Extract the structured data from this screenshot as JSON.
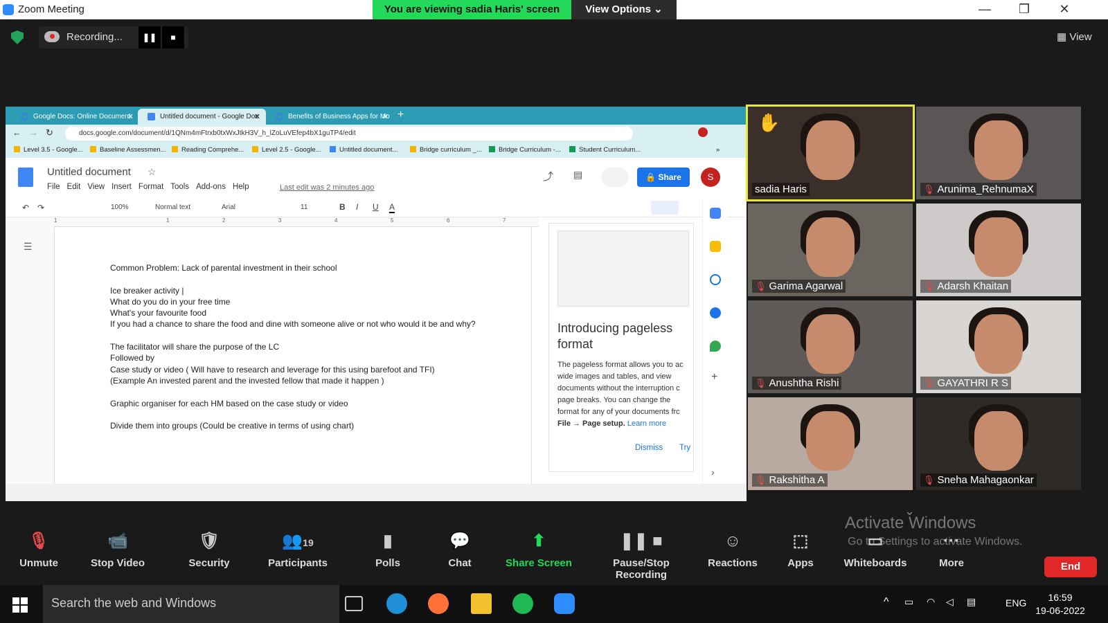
{
  "window": {
    "title": "Zoom Meeting",
    "viewing_banner": "You are viewing sadia Haris' screen",
    "view_options": "View Options ⌄"
  },
  "recording": {
    "label": "Recording...",
    "pause": "❚❚",
    "stop": "■"
  },
  "view_button": "View",
  "browser": {
    "tabs": [
      {
        "label": "Google Docs: Online Document"
      },
      {
        "label": "Untitled document - Google Doc"
      },
      {
        "label": "Benefits of Business Apps for Mo"
      }
    ],
    "new_tab": "+",
    "url": "docs.google.com/document/d/1QNm4mFtrxb0txWxJtkH3V_h_lZoLuVEfep4bX1guTP4/edit",
    "bookmarks": [
      "Level 3.5 - Google...",
      "Baseline Assessmen...",
      "Reading Comprehe...",
      "Level 2.5 - Google...",
      "Untitled document...",
      "Bridge curriculum _...",
      "Bridge Curriculum -...",
      "Student Curriculum..."
    ],
    "bookmarks_more": "»"
  },
  "doc": {
    "title": "Untitled document",
    "menus": [
      "File",
      "Edit",
      "View",
      "Insert",
      "Format",
      "Tools",
      "Add-ons",
      "Help"
    ],
    "last_edit": "Last edit was 2 minutes ago",
    "share": "🔒 Share",
    "avatar": "S",
    "zoom": "100%",
    "style": "Normal text",
    "font": "Arial",
    "font_size": "11",
    "ruler_ticks": [
      "1",
      "1",
      "2",
      "3",
      "4",
      "5",
      "6",
      "7"
    ],
    "body_lines": "Common Problem:  Lack of parental investment in their school\n\nIce breaker activity |\nWhat do you do in your free time\nWhat's your favourite food\nIf you had a chance to share the food and dine with someone alive or not who would it be and why?\n\nThe facilitator  will share the purpose of the LC\nFollowed by\nCase study or video (  Will have to research and leverage for this using barefoot and TFI)\n(Example An invested parent and the invested fellow that made it happen  )\n\nGraphic organiser for each HM based on the case study or video\n\nDivide them into groups (Could be creative in terms of using chart)"
  },
  "side_panel": {
    "title": "Introducing pageless format",
    "body": "The pageless format allows you to ac wide images and tables, and view documents without the interruption c page breaks. You can change the format for any of your documents frc",
    "body_bold": "File → Page setup.",
    "learn_more": "Learn more",
    "dismiss": "Dismiss",
    "try": "Try"
  },
  "participants": [
    {
      "name": "sadia Haris",
      "muted": false,
      "active": true
    },
    {
      "name": "Arunima_RehnumaX",
      "muted": true
    },
    {
      "name": "Garima Agarwal",
      "muted": true
    },
    {
      "name": "Adarsh Khaitan",
      "muted": true
    },
    {
      "name": "Anushtha Rishi",
      "muted": true
    },
    {
      "name": "GAYATHRI R S",
      "muted": true
    },
    {
      "name": "Rakshitha A",
      "muted": true
    },
    {
      "name": "Sneha  Mahagaonkar",
      "muted": true
    }
  ],
  "controls": [
    {
      "label": "Unmute",
      "icon": "🎙"
    },
    {
      "label": "Stop Video",
      "icon": "📹"
    },
    {
      "label": "Security",
      "icon": "🛡"
    },
    {
      "label": "Participants",
      "icon": "👥",
      "count": "19"
    },
    {
      "label": "Polls",
      "icon": "▮"
    },
    {
      "label": "Chat",
      "icon": "💬"
    },
    {
      "label": "Share Screen",
      "icon": "⬆"
    },
    {
      "label": "Pause/Stop Recording",
      "icon": "❚❚ ■"
    },
    {
      "label": "Reactions",
      "icon": "☺"
    },
    {
      "label": "Apps",
      "icon": "⬚"
    },
    {
      "label": "Whiteboards",
      "icon": "▭"
    },
    {
      "label": "More",
      "icon": "···"
    }
  ],
  "end": "End",
  "watermark": {
    "title": "Activate Windows",
    "subtitle": "Go to Settings to activate Windows."
  },
  "taskbar": {
    "search": "Search the web and Windows",
    "lang": "ENG",
    "time": "16:59",
    "date": "19-06-2022"
  },
  "colors": {
    "zoom_green": "#23d959",
    "active_speaker": "#e6e83c",
    "end_red": "#e02828",
    "docs_blue": "#1a73e8"
  }
}
